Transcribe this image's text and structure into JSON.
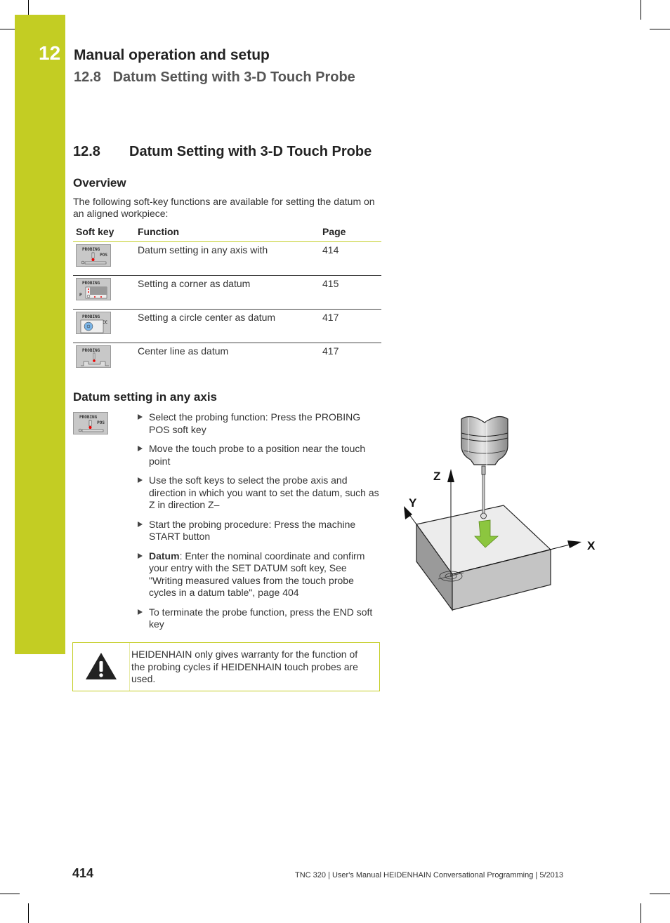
{
  "header": {
    "chapter_number": "12",
    "chapter_title": "Manual operation and setup",
    "section_ref": "12.8   Datum Setting with 3-D Touch Probe"
  },
  "section": {
    "number": "12.8",
    "title": "Datum Setting with 3-D Touch Probe"
  },
  "overview": {
    "heading": "Overview",
    "intro": "The following soft-key functions are available for setting the datum on an aligned workpiece:",
    "table": {
      "headers": [
        "Soft key",
        "Function",
        "Page"
      ],
      "rows": [
        {
          "softkey": {
            "label": "PROBING",
            "sub": "POS",
            "icon": "probing-pos-icon"
          },
          "function": "Datum setting in any axis with",
          "page": "414"
        },
        {
          "softkey": {
            "label": "PROBING",
            "sub": "P",
            "icon": "probing-corner-icon"
          },
          "function": "Setting a corner as datum",
          "page": "415"
        },
        {
          "softkey": {
            "label": "PROBING",
            "sub": "CC",
            "icon": "probing-circle-center-icon"
          },
          "function": "Setting a circle center as datum",
          "page": "417"
        },
        {
          "softkey": {
            "label": "PROBING",
            "sub": "",
            "icon": "probing-center-line-icon"
          },
          "function": "Center line as datum",
          "page": "417"
        }
      ]
    }
  },
  "datum_any_axis": {
    "heading": "Datum setting in any axis",
    "softkey": {
      "label": "PROBING",
      "sub": "POS"
    },
    "steps": [
      {
        "bold": "",
        "text": "Select the probing function: Press the PROBING POS soft key"
      },
      {
        "bold": "",
        "text": "Move the touch probe to a position near the touch point"
      },
      {
        "bold": "",
        "text": "Use the soft keys to select the probe axis and direction in which you want to set the datum, such as Z in direction Z–"
      },
      {
        "bold": "",
        "text": "Start the probing procedure: Press the machine START button"
      },
      {
        "bold": "Datum",
        "text": ": Enter the nominal coordinate and confirm your entry with the SET DATUM soft key, See \"Writing measured values from the touch probe cycles in a datum table\", page 404"
      },
      {
        "bold": "",
        "text": "To terminate the probe function, press the END soft key"
      }
    ],
    "figure": {
      "axis_labels": {
        "x": "X",
        "y": "Y",
        "z": "Z"
      },
      "arrow_color": "#8cc63f"
    }
  },
  "warning": {
    "icon": "warning-icon",
    "text": "HEIDENHAIN only gives warranty for the function of the probing cycles if HEIDENHAIN touch probes are used."
  },
  "footer": {
    "page_number": "414",
    "text": "TNC 320 | User's Manual HEIDENHAIN Conversational Programming | 5/2013"
  },
  "colors": {
    "accent": "#c3cd23"
  }
}
